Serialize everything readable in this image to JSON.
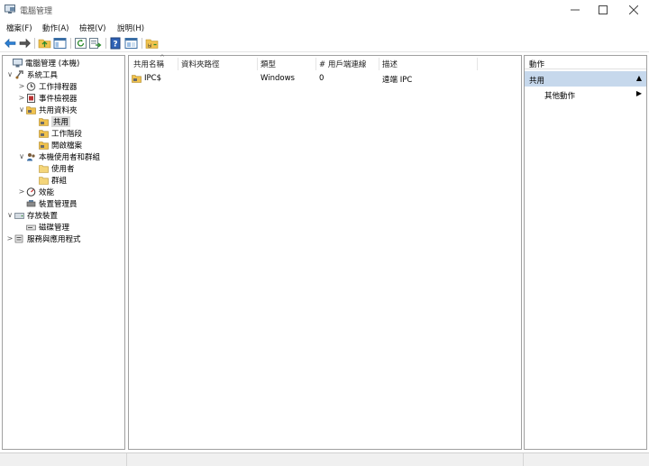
{
  "window": {
    "title": "電腦管理",
    "minimize_icon": "minimize-icon",
    "maximize_icon": "maximize-icon",
    "close_icon": "close-icon"
  },
  "menu": [
    "檔案(F)",
    "動作(A)",
    "檢視(V)",
    "說明(H)"
  ],
  "toolbar": {
    "icons": [
      "back-arrow-icon",
      "forward-arrow-icon",
      "up-folder-icon",
      "show-hide-tree-icon",
      "refresh-icon",
      "export-list-icon",
      "help-icon",
      "properties-icon",
      "share-icon"
    ]
  },
  "tree": [
    {
      "label": "電腦管理 (本機)",
      "icon": "computer-management-icon",
      "expander": ""
    },
    {
      "label": "系統工具",
      "icon": "system-tools-icon",
      "expander": "∨"
    },
    {
      "label": "工作排程器",
      "icon": "task-scheduler-icon",
      "expander": ">"
    },
    {
      "label": "事件檢視器",
      "icon": "event-viewer-icon",
      "expander": ">"
    },
    {
      "label": "共用資料夾",
      "icon": "shared-folder-icon",
      "expander": "∨"
    },
    {
      "label": "共用",
      "icon": "share-icon",
      "expander": "",
      "selected": true
    },
    {
      "label": "工作階段",
      "icon": "sessions-icon",
      "expander": ""
    },
    {
      "label": "開啟檔案",
      "icon": "open-files-icon",
      "expander": ""
    },
    {
      "label": "本機使用者和群組",
      "icon": "users-groups-icon",
      "expander": "∨"
    },
    {
      "label": "使用者",
      "icon": "folder-icon",
      "expander": ""
    },
    {
      "label": "群組",
      "icon": "folder-icon",
      "expander": ""
    },
    {
      "label": "效能",
      "icon": "performance-icon",
      "expander": ">"
    },
    {
      "label": "裝置管理員",
      "icon": "device-manager-icon",
      "expander": ""
    },
    {
      "label": "存放裝置",
      "icon": "storage-icon",
      "expander": "∨"
    },
    {
      "label": "磁碟管理",
      "icon": "disk-management-icon",
      "expander": ""
    },
    {
      "label": "服務與應用程式",
      "icon": "services-apps-icon",
      "expander": ">"
    }
  ],
  "list": {
    "columns": [
      "共用名稱",
      "資料夾路徑",
      "類型",
      "# 用戶端連線",
      "描述"
    ],
    "rows": [
      {
        "name": "IPC$",
        "path": "",
        "type": "Windows",
        "connections": "0",
        "description": "遠端 IPC"
      }
    ]
  },
  "actions": {
    "title": "動作",
    "section": "共用",
    "items": [
      {
        "label": "其他動作"
      }
    ]
  }
}
